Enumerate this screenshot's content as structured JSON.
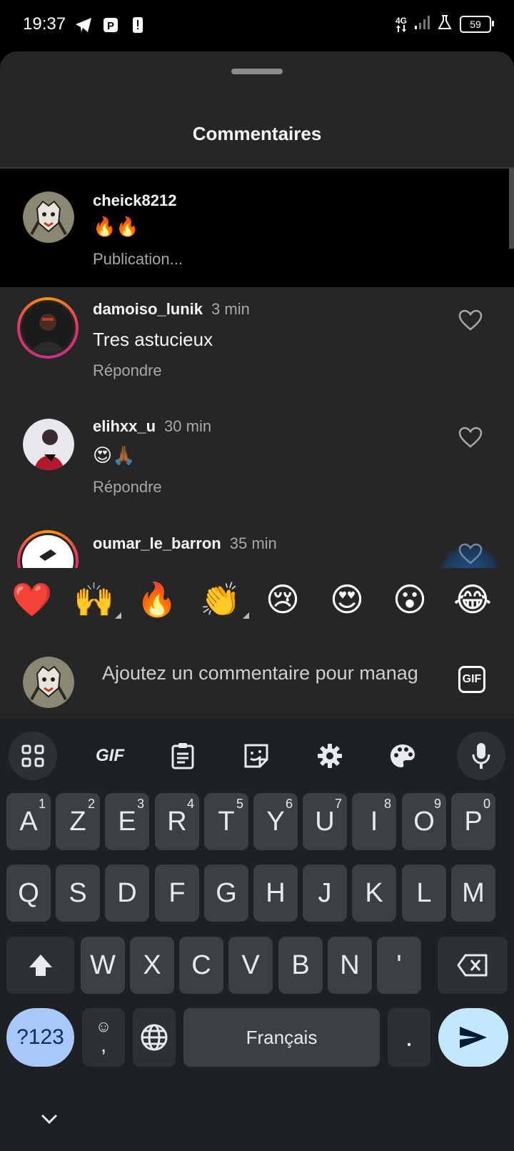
{
  "status_bar": {
    "time": "19:37",
    "network": "4G",
    "battery": "59"
  },
  "sheet": {
    "title": "Commentaires"
  },
  "caption": {
    "username": "cheick8212",
    "text": "🔥🔥",
    "subtext": "Publication..."
  },
  "comments": [
    {
      "username": "damoiso_lunik",
      "time": "3 min",
      "text": "Tres astucieux",
      "reply": "Répondre",
      "liked": false
    },
    {
      "username": "elihxx_u",
      "time": "30 min",
      "text": "😍🙏🏾",
      "reply": "Répondre",
      "liked": false
    },
    {
      "username": "oumar_le_barron",
      "time": "35 min",
      "liked": false
    }
  ],
  "emoji_bar": [
    "❤️",
    "🙌",
    "🔥",
    "👏",
    "😢",
    "😍",
    "😮",
    "😂"
  ],
  "comment_input": {
    "placeholder": "Ajoutez un commentaire pour manag",
    "gif_label": "GIF"
  },
  "keyboard": {
    "toolbar": {
      "gif_label": "GIF"
    },
    "row1": [
      {
        "key": "A",
        "hint": "1"
      },
      {
        "key": "Z",
        "hint": "2"
      },
      {
        "key": "E",
        "hint": "3"
      },
      {
        "key": "R",
        "hint": "4"
      },
      {
        "key": "T",
        "hint": "5"
      },
      {
        "key": "Y",
        "hint": "6"
      },
      {
        "key": "U",
        "hint": "7"
      },
      {
        "key": "I",
        "hint": "8"
      },
      {
        "key": "O",
        "hint": "9"
      },
      {
        "key": "P",
        "hint": "0"
      }
    ],
    "row2": [
      "Q",
      "S",
      "D",
      "F",
      "G",
      "H",
      "J",
      "K",
      "L",
      "M"
    ],
    "row3": [
      "W",
      "X",
      "C",
      "V",
      "B",
      "N",
      "'"
    ],
    "symbols_label": "?123",
    "comma_label": ",",
    "space_label": "Français",
    "period_label": "."
  },
  "colors": {
    "sheet_bg": "#262626",
    "keyboard_bg": "#1e2123",
    "key_bg": "#3c4043",
    "accent_blue": "#c2e7ff",
    "symbols_key": "#a8c7fa"
  }
}
